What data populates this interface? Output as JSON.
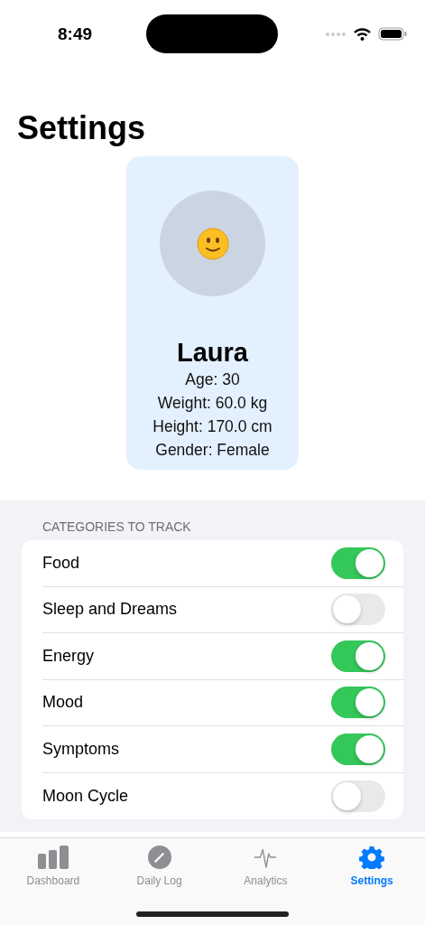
{
  "status_bar": {
    "time": "8:49"
  },
  "title": "Settings",
  "profile": {
    "name": "Laura",
    "details": [
      "Age: 30",
      "Weight: 60.0 kg",
      "Height: 170.0 cm",
      "Gender: Female"
    ]
  },
  "categories": {
    "header": "CATEGORIES TO TRACK",
    "items": [
      {
        "label": "Food",
        "on": true
      },
      {
        "label": "Sleep and Dreams",
        "on": false
      },
      {
        "label": "Energy",
        "on": true
      },
      {
        "label": "Mood",
        "on": true
      },
      {
        "label": "Symptoms",
        "on": true
      },
      {
        "label": "Moon Cycle",
        "on": false
      }
    ]
  },
  "tab_bar": [
    {
      "label": "Dashboard",
      "kind": "chart",
      "selected": false
    },
    {
      "label": "Daily Log",
      "kind": "pencil",
      "selected": false
    },
    {
      "label": "Analytics",
      "kind": "pulse",
      "selected": false
    },
    {
      "label": "Settings",
      "kind": "gear",
      "selected": true
    }
  ]
}
